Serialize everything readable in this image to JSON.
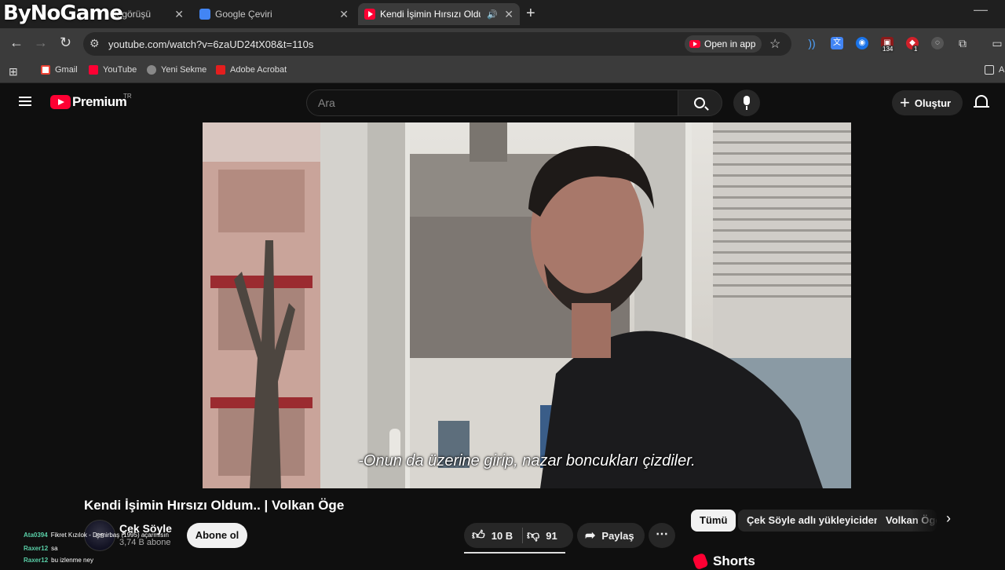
{
  "watermark": "ByNoGame",
  "browser": {
    "tabs": [
      {
        "label": "k görüşü",
        "active": false
      },
      {
        "label": "Google Çeviri",
        "active": false
      },
      {
        "label": "Kendi İşimin Hırsızı Oldum..",
        "active": true
      }
    ],
    "url": "youtube.com/watch?v=6zaUD24tX08&t=110s",
    "open_in_app": "Open in app",
    "extension_badges": [
      "134",
      "1"
    ],
    "bookmarks": [
      "Gmail",
      "YouTube",
      "Yeni Sekme",
      "Adobe Acrobat"
    ],
    "bookmark_overflow": "A"
  },
  "youtube": {
    "brand": "Premium",
    "region": "TR",
    "search_placeholder": "Ara",
    "create_label": "Oluştur"
  },
  "video": {
    "subtitle": "-Onun da üzerine girip, nazar boncukları çizdiler.",
    "title": "Kendi İşimin Hırsızı Oldum.. | Volkan Öge",
    "channel": "Çek Söyle",
    "subscribers": "3,74 B abone",
    "subscribe_label": "Abone ol",
    "likes": "10 B",
    "dislikes": "91",
    "share_label": "Paylaş",
    "more_label": "⋯"
  },
  "chat": [
    {
      "user": "Ata0394",
      "text": "Fikret Kızılok - Demirbaş (1995) açarmısın"
    },
    {
      "user": "Raxer12",
      "text": "sa"
    },
    {
      "user": "Raxer12",
      "text": "bu izlenme ney"
    }
  ],
  "chips": [
    "Tümü",
    "Çek Söyle adlı yükleyiciden",
    "Volkan Öge"
  ],
  "shorts_label": "Shorts",
  "colors": {
    "accent": "#ff0033",
    "background": "#0f0f0f",
    "chip": "#272727"
  }
}
